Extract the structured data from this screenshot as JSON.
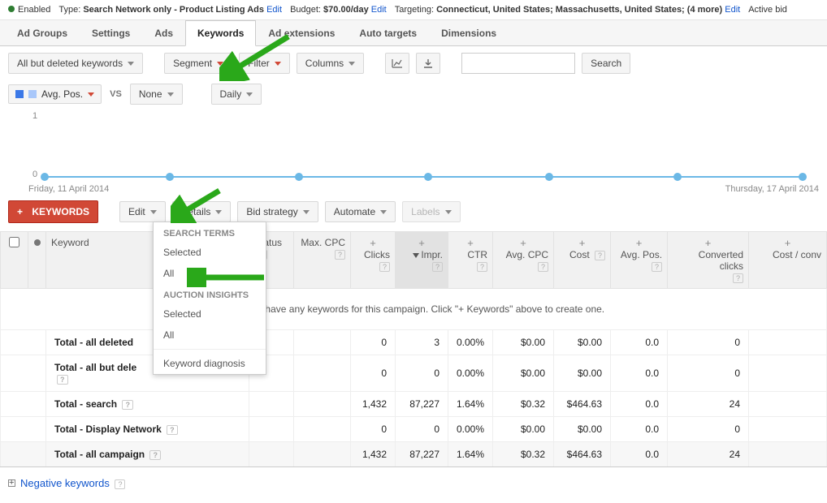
{
  "top": {
    "enabled": "Enabled",
    "type_label": "Type:",
    "type_value": "Search Network only - Product Listing Ads",
    "edit": "Edit",
    "budget_label": "Budget:",
    "budget_value": "$70.00/day",
    "targeting_label": "Targeting:",
    "targeting_value": "Connecticut, United States; Massachusetts, United States; (4 more)",
    "active_bid": "Active bid"
  },
  "tabs": [
    "Ad Groups",
    "Settings",
    "Ads",
    "Keywords",
    "Ad extensions",
    "Auto targets",
    "Dimensions"
  ],
  "active_tab": 3,
  "toolbar": {
    "all_but_deleted": "All but deleted keywords",
    "segment": "Segment",
    "filter": "Filter",
    "columns": "Columns",
    "search": "Search"
  },
  "chips": {
    "avg_pos": "Avg. Pos.",
    "vs": "VS",
    "none": "None",
    "daily": "Daily"
  },
  "chart": {
    "y1": "1",
    "y0": "0",
    "date_from": "Friday, 11 April 2014",
    "date_to": "Thursday, 17 April 2014"
  },
  "actions": {
    "keywords_btn": "KEYWORDS",
    "edit": "Edit",
    "details": "Details",
    "bid_strategy": "Bid strategy",
    "automate": "Automate",
    "labels": "Labels"
  },
  "dropdown": {
    "h1": "SEARCH TERMS",
    "selected": "Selected",
    "all": "All",
    "h2": "AUCTION INSIGHTS",
    "kd": "Keyword diagnosis"
  },
  "columns": {
    "keyword": "Keyword",
    "status": "Status",
    "max_cpc": "Max. CPC",
    "clicks": "Clicks",
    "impr": "Impr.",
    "ctr": "CTR",
    "avg_cpc": "Avg. CPC",
    "cost": "Cost",
    "avg_pos": "Avg. Pos.",
    "conv_clicks": "Converted clicks",
    "cost_conv": "Cost / conv"
  },
  "empty_msg": "You don't have any keywords for this campaign. Click \"+ Keywords\" above to create one.",
  "totals": [
    {
      "label": "Total - all deleted",
      "clicks": "0",
      "impr": "3",
      "ctr": "0.00%",
      "avg_cpc": "$0.00",
      "cost": "$0.00",
      "avg_pos": "0.0",
      "conv": "0"
    },
    {
      "label": "Total - all but dele",
      "clicks": "0",
      "impr": "0",
      "ctr": "0.00%",
      "avg_cpc": "$0.00",
      "cost": "$0.00",
      "avg_pos": "0.0",
      "conv": "0"
    },
    {
      "label": "Total - search",
      "clicks": "1,432",
      "impr": "87,227",
      "ctr": "1.64%",
      "avg_cpc": "$0.32",
      "cost": "$464.63",
      "avg_pos": "0.0",
      "conv": "24"
    },
    {
      "label": "Total - Display Network",
      "clicks": "0",
      "impr": "0",
      "ctr": "0.00%",
      "avg_cpc": "$0.00",
      "cost": "$0.00",
      "avg_pos": "0.0",
      "conv": "0"
    },
    {
      "label": "Total - all campaign",
      "clicks": "1,432",
      "impr": "87,227",
      "ctr": "1.64%",
      "avg_cpc": "$0.32",
      "cost": "$464.63",
      "avg_pos": "0.0",
      "conv": "24"
    }
  ],
  "neg": "Negative keywords"
}
